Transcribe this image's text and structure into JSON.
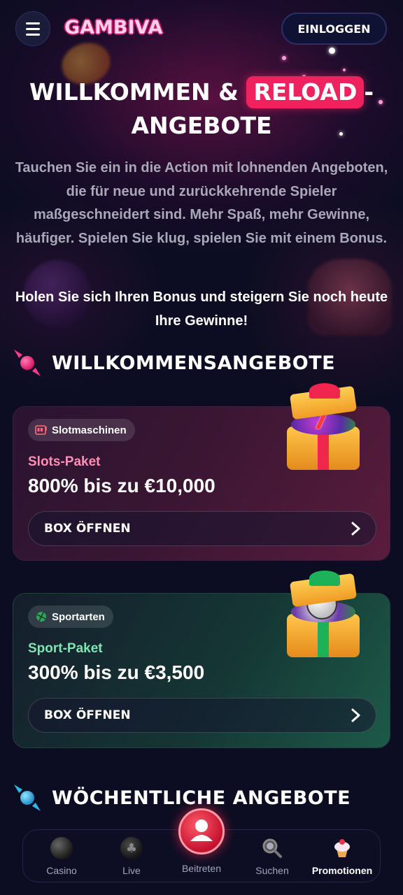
{
  "header": {
    "logo_text": "GAMBIVA",
    "login_label": "EINLOGGEN"
  },
  "hero": {
    "title_part1": "WILLKOMMEN &",
    "title_highlight": "RELOAD",
    "title_part2": "-",
    "title_line2": "ANGEBOTE",
    "description": "Tauchen Sie ein in die Action mit lohnenden Angeboten, die für neue und zurückkehrende Spieler maßgeschneidert sind. Mehr Spaß, mehr Gewinne, häufiger. Spielen Sie klug, spielen Sie mit einem Bonus.",
    "cta_text": "Holen Sie sich Ihren Bonus und steigern Sie noch heute Ihre Gewinne!"
  },
  "sections": {
    "welcome_title": "WILLKOMMENSANGEBOTE",
    "weekly_title": "WÖCHENTLICHE ANGEBOTE"
  },
  "offers": [
    {
      "category": "Slotmaschinen",
      "category_icon": "slot-machine-icon",
      "package_name": "Slots-Paket",
      "amount": "800% bis zu €10,000",
      "button_label": "BOX ÖFFNEN",
      "accent": "#ff8fb6"
    },
    {
      "category": "Sportarten",
      "category_icon": "sports-ball-icon",
      "package_name": "Sport-Paket",
      "amount": "300% bis zu €3,500",
      "button_label": "BOX ÖFFNEN",
      "accent": "#7ee6b0"
    }
  ],
  "nav": {
    "items": [
      {
        "label": "Casino",
        "icon": "bomb-icon"
      },
      {
        "label": "Live",
        "icon": "clubs-icon"
      },
      {
        "label": "Beitreten",
        "icon": "user-join-icon"
      },
      {
        "label": "Suchen",
        "icon": "search-icon"
      },
      {
        "label": "Promotionen",
        "icon": "cupcake-icon",
        "active": true
      }
    ]
  },
  "colors": {
    "background": "#0c0d22",
    "brand_pink": "#f0215f",
    "join_red": "#c4122f"
  }
}
